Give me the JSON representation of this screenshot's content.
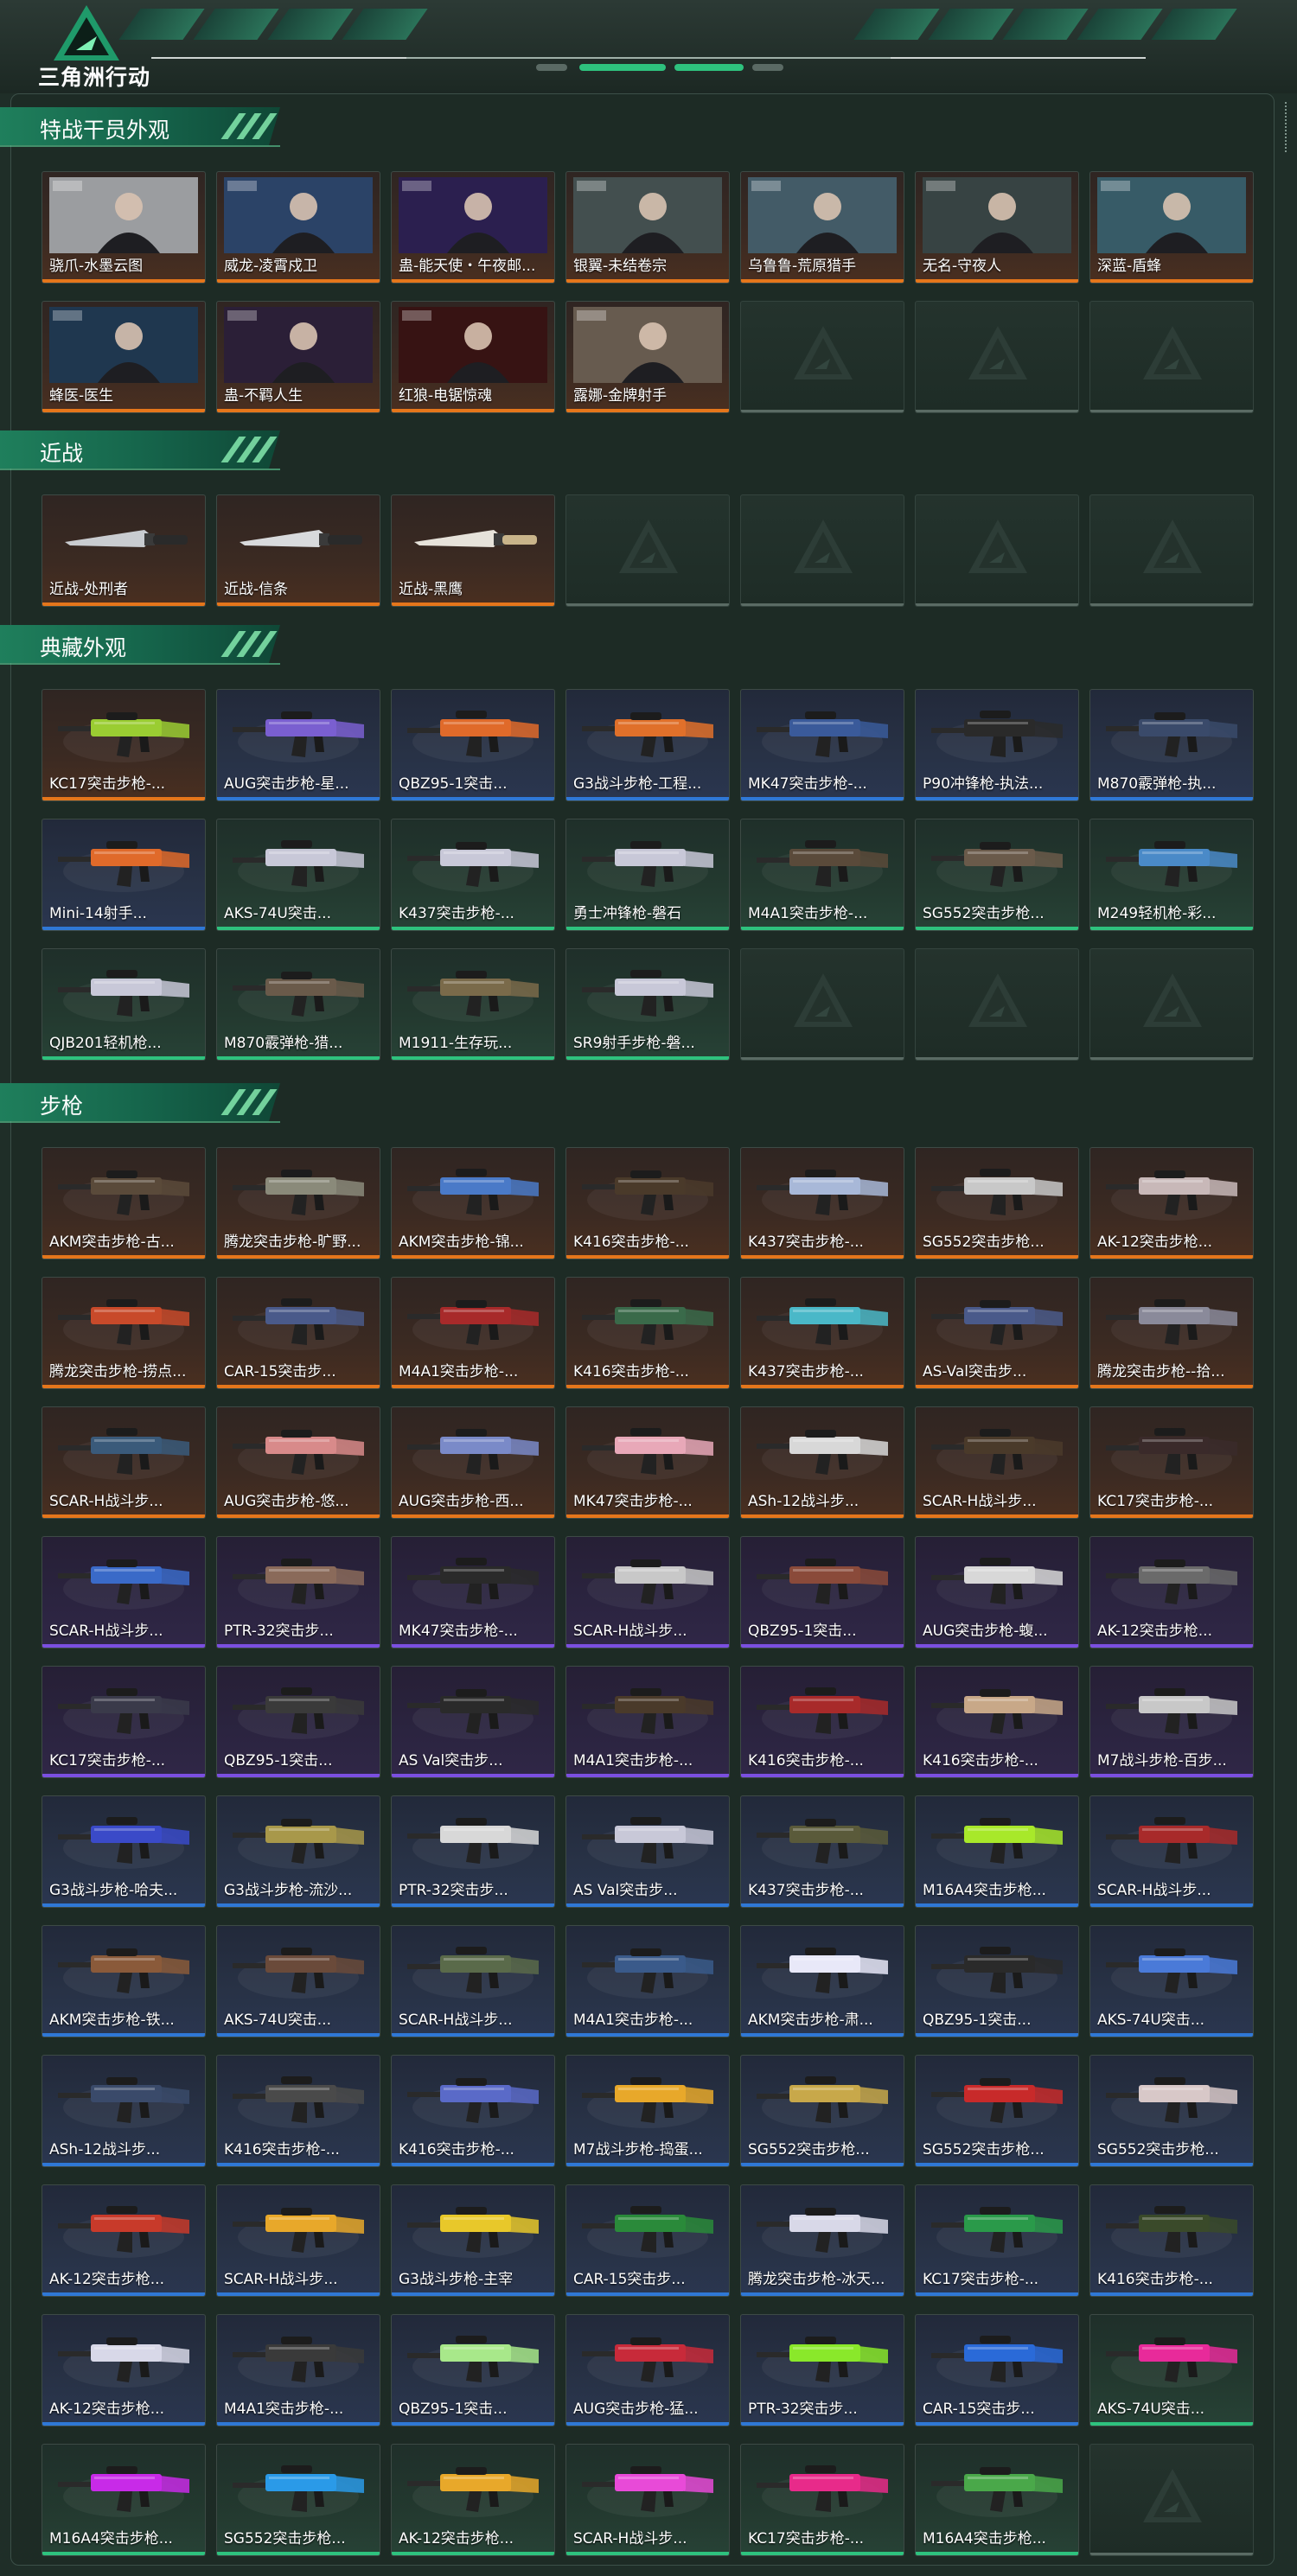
{
  "app": {
    "logo_text": "三角洲行动"
  },
  "colors": {
    "accent_green": "#2ec27e",
    "rarity_orange": "#e5761b",
    "rarity_blue": "#2f78d6",
    "rarity_purple": "#7b4fe0",
    "rarity_green": "#2ec27e",
    "empty_bar": "#5a6b64"
  },
  "sections": [
    {
      "id": "operators",
      "title": "特战干员外观",
      "items": [
        {
          "name": "骁爪-水墨云图",
          "rarity": "orange",
          "icon": "operator-portrait"
        },
        {
          "name": "威龙-凌霄戍卫",
          "rarity": "orange",
          "icon": "operator-portrait"
        },
        {
          "name": "蛊-能天使・午夜邮...",
          "rarity": "orange",
          "icon": "operator-portrait"
        },
        {
          "name": "银翼-未结卷宗",
          "rarity": "orange",
          "icon": "operator-portrait"
        },
        {
          "name": "乌鲁鲁-荒原猎手",
          "rarity": "orange",
          "icon": "operator-portrait"
        },
        {
          "name": "无名-守夜人",
          "rarity": "orange",
          "icon": "operator-portrait"
        },
        {
          "name": "深蓝-盾蜂",
          "rarity": "orange",
          "icon": "operator-portrait"
        },
        {
          "name": "蜂医-医生",
          "rarity": "orange",
          "icon": "operator-portrait"
        },
        {
          "name": "蛊-不羁人生",
          "rarity": "orange",
          "icon": "operator-portrait"
        },
        {
          "name": "红狼-电锯惊魂",
          "rarity": "orange",
          "icon": "operator-portrait"
        },
        {
          "name": "露娜-金牌射手",
          "rarity": "orange",
          "icon": "operator-portrait"
        },
        {
          "empty": true
        },
        {
          "empty": true
        },
        {
          "empty": true
        }
      ]
    },
    {
      "id": "melee",
      "title": "近战",
      "items": [
        {
          "name": "近战-处刑者",
          "rarity": "orange",
          "icon": "knife"
        },
        {
          "name": "近战-信条",
          "rarity": "orange",
          "icon": "knife"
        },
        {
          "name": "近战-黑鹰",
          "rarity": "orange",
          "icon": "knife"
        },
        {
          "empty": true
        },
        {
          "empty": true
        },
        {
          "empty": true
        },
        {
          "empty": true
        }
      ]
    },
    {
      "id": "collection",
      "title": "典藏外观",
      "items": [
        {
          "name": "KC17突击步枪-...",
          "rarity": "orange",
          "icon": "rifle",
          "skin": "#9acd32"
        },
        {
          "name": "AUG突击步枪-星...",
          "rarity": "blue",
          "icon": "rifle",
          "skin": "#7a5fd0"
        },
        {
          "name": "QBZ95-1突击...",
          "rarity": "blue",
          "icon": "rifle",
          "skin": "#e06a2a"
        },
        {
          "name": "G3战斗步枪-工程...",
          "rarity": "blue",
          "icon": "rifle",
          "skin": "#e0702a"
        },
        {
          "name": "MK47突击步枪-...",
          "rarity": "blue",
          "icon": "rifle",
          "skin": "#3a5a9a"
        },
        {
          "name": "P90冲锋枪-执法...",
          "rarity": "blue",
          "icon": "rifle",
          "skin": "#2a2a2a"
        },
        {
          "name": "M870霰弹枪-执...",
          "rarity": "blue",
          "icon": "rifle",
          "skin": "#3a4a6a"
        },
        {
          "name": "Mini-14射手...",
          "rarity": "blue",
          "icon": "rifle",
          "skin": "#e06a2a"
        },
        {
          "name": "AKS-74U突击...",
          "rarity": "green",
          "icon": "rifle",
          "skin": "#c8c8d8"
        },
        {
          "name": "K437突击步枪-...",
          "rarity": "green",
          "icon": "rifle",
          "skin": "#c8c8d8"
        },
        {
          "name": "勇士冲锋枪-磐石",
          "rarity": "green",
          "icon": "rifle",
          "skin": "#c8c8d8"
        },
        {
          "name": "M4A1突击步枪-...",
          "rarity": "green",
          "icon": "rifle",
          "skin": "#5a4a3a"
        },
        {
          "name": "SG552突击步枪...",
          "rarity": "green",
          "icon": "rifle",
          "skin": "#6a5a4a"
        },
        {
          "name": "M249轻机枪-彩...",
          "rarity": "green",
          "icon": "rifle",
          "skin": "#4a8ac8"
        },
        {
          "name": "QJB201轻机枪...",
          "rarity": "green",
          "icon": "rifle",
          "skin": "#c8c8d8"
        },
        {
          "name": "M870霰弹枪-猎...",
          "rarity": "green",
          "icon": "rifle",
          "skin": "#6a5a4a"
        },
        {
          "name": "M1911-生存玩...",
          "rarity": "green",
          "icon": "rifle",
          "skin": "#7a6a4a"
        },
        {
          "name": "SR9射手步枪-磐...",
          "rarity": "green",
          "icon": "rifle",
          "skin": "#c8c8d8"
        },
        {
          "empty": true
        },
        {
          "empty": true
        },
        {
          "empty": true
        }
      ]
    },
    {
      "id": "rifles",
      "title": "步枪",
      "items": [
        {
          "name": "AKM突击步枪-古...",
          "rarity": "orange",
          "icon": "rifle",
          "skin": "#5a4a3a"
        },
        {
          "name": "腾龙突击步枪-旷野...",
          "rarity": "orange",
          "icon": "rifle",
          "skin": "#8a8a7a"
        },
        {
          "name": "AKM突击步枪-锦...",
          "rarity": "orange",
          "icon": "rifle",
          "skin": "#4a7ac8"
        },
        {
          "name": "K416突击步枪-...",
          "rarity": "orange",
          "icon": "rifle",
          "skin": "#4a3a2a"
        },
        {
          "name": "K437突击步枪-...",
          "rarity": "orange",
          "icon": "rifle",
          "skin": "#a8b8d8"
        },
        {
          "name": "SG552突击步枪...",
          "rarity": "orange",
          "icon": "rifle",
          "skin": "#c8c8c8"
        },
        {
          "name": "AK-12突击步枪...",
          "rarity": "orange",
          "icon": "rifle",
          "skin": "#c8b8b8"
        },
        {
          "name": "腾龙突击步枪-捞点...",
          "rarity": "orange",
          "icon": "rifle",
          "skin": "#c84a2a"
        },
        {
          "name": "CAR-15突击步...",
          "rarity": "orange",
          "icon": "rifle",
          "skin": "#4a5a8a"
        },
        {
          "name": "M4A1突击步枪-...",
          "rarity": "orange",
          "icon": "rifle",
          "skin": "#a82a2a"
        },
        {
          "name": "K416突击步枪-...",
          "rarity": "orange",
          "icon": "rifle",
          "skin": "#3a6a4a"
        },
        {
          "name": "K437突击步枪-...",
          "rarity": "orange",
          "icon": "rifle",
          "skin": "#4ab8c8"
        },
        {
          "name": "AS-Val突击步...",
          "rarity": "orange",
          "icon": "rifle",
          "skin": "#4a5a8a"
        },
        {
          "name": "腾龙突击步枪--拾...",
          "rarity": "orange",
          "icon": "rifle",
          "skin": "#8a8a9a"
        },
        {
          "name": "SCAR-H战斗步...",
          "rarity": "orange",
          "icon": "rifle",
          "skin": "#3a5a7a"
        },
        {
          "name": "AUG突击步枪-悠...",
          "rarity": "orange",
          "icon": "rifle",
          "skin": "#d88a8a"
        },
        {
          "name": "AUG突击步枪-西...",
          "rarity": "orange",
          "icon": "rifle",
          "skin": "#7a8ac8"
        },
        {
          "name": "MK47突击步枪-...",
          "rarity": "orange",
          "icon": "rifle",
          "skin": "#e8a8b8"
        },
        {
          "name": "ASh-12战斗步...",
          "rarity": "orange",
          "icon": "rifle",
          "skin": "#d8d8d8"
        },
        {
          "name": "SCAR-H战斗步...",
          "rarity": "orange",
          "icon": "rifle",
          "skin": "#4a3a2a"
        },
        {
          "name": "KC17突击步枪-...",
          "rarity": "orange",
          "icon": "rifle",
          "skin": "#3a2a2a"
        },
        {
          "name": "SCAR-H战斗步...",
          "rarity": "purple",
          "icon": "rifle",
          "skin": "#3a6ac8"
        },
        {
          "name": "PTR-32突击步...",
          "rarity": "purple",
          "icon": "rifle",
          "skin": "#8a6a5a"
        },
        {
          "name": "MK47突击步枪-...",
          "rarity": "purple",
          "icon": "rifle",
          "skin": "#2a2a2a"
        },
        {
          "name": "SCAR-H战斗步...",
          "rarity": "purple",
          "icon": "rifle",
          "skin": "#c8c8c8"
        },
        {
          "name": "QBZ95-1突击...",
          "rarity": "purple",
          "icon": "rifle",
          "skin": "#8a4a3a"
        },
        {
          "name": "AUG突击步枪-蝮...",
          "rarity": "purple",
          "icon": "rifle",
          "skin": "#d8d8d8"
        },
        {
          "name": "AK-12突击步枪...",
          "rarity": "purple",
          "icon": "rifle",
          "skin": "#6a6a6a"
        },
        {
          "name": "KC17突击步枪-...",
          "rarity": "purple",
          "icon": "rifle",
          "skin": "#3a3a4a"
        },
        {
          "name": "QBZ95-1突击...",
          "rarity": "purple",
          "icon": "rifle",
          "skin": "#3a3a3a"
        },
        {
          "name": "AS Val突击步...",
          "rarity": "purple",
          "icon": "rifle",
          "skin": "#2a2a2a"
        },
        {
          "name": "M4A1突击步枪-...",
          "rarity": "purple",
          "icon": "rifle",
          "skin": "#4a3a2a"
        },
        {
          "name": "K416突击步枪-...",
          "rarity": "purple",
          "icon": "rifle",
          "skin": "#a82a2a"
        },
        {
          "name": "K416突击步枪-...",
          "rarity": "purple",
          "icon": "rifle",
          "skin": "#c8a888"
        },
        {
          "name": "M7战斗步枪-百步...",
          "rarity": "purple",
          "icon": "rifle",
          "skin": "#c8c8c8"
        },
        {
          "name": "G3战斗步枪-哈夫...",
          "rarity": "blue",
          "icon": "rifle",
          "skin": "#3a4ac8"
        },
        {
          "name": "G3战斗步枪-流沙...",
          "rarity": "blue",
          "icon": "rifle",
          "skin": "#a8984a"
        },
        {
          "name": "PTR-32突击步...",
          "rarity": "blue",
          "icon": "rifle",
          "skin": "#d8d8d8"
        },
        {
          "name": "AS Val突击步...",
          "rarity": "blue",
          "icon": "rifle",
          "skin": "#c8c8d8"
        },
        {
          "name": "K437突击步枪-...",
          "rarity": "blue",
          "icon": "rifle",
          "skin": "#5a5a3a"
        },
        {
          "name": "M16A4突击步枪...",
          "rarity": "blue",
          "icon": "rifle",
          "skin": "#a8e82a"
        },
        {
          "name": "SCAR-H战斗步...",
          "rarity": "blue",
          "icon": "rifle",
          "skin": "#a82a2a"
        },
        {
          "name": "AKM突击步枪-铁...",
          "rarity": "blue",
          "icon": "rifle",
          "skin": "#8a5a3a"
        },
        {
          "name": "AKS-74U突击...",
          "rarity": "blue",
          "icon": "rifle",
          "skin": "#6a4a3a"
        },
        {
          "name": "SCAR-H战斗步...",
          "rarity": "blue",
          "icon": "rifle",
          "skin": "#5a6a4a"
        },
        {
          "name": "M4A1突击步枪-...",
          "rarity": "blue",
          "icon": "rifle",
          "skin": "#3a5a8a"
        },
        {
          "name": "AKM突击步枪-肃...",
          "rarity": "blue",
          "icon": "rifle",
          "skin": "#e8e8f8"
        },
        {
          "name": "QBZ95-1突击...",
          "rarity": "blue",
          "icon": "rifle",
          "skin": "#2a2a2a"
        },
        {
          "name": "AKS-74U突击...",
          "rarity": "blue",
          "icon": "rifle",
          "skin": "#4a7ad8"
        },
        {
          "name": "ASh-12战斗步...",
          "rarity": "blue",
          "icon": "rifle",
          "skin": "#3a4a6a"
        },
        {
          "name": "K416突击步枪-...",
          "rarity": "blue",
          "icon": "rifle",
          "skin": "#4a4a4a"
        },
        {
          "name": "K416突击步枪-...",
          "rarity": "blue",
          "icon": "rifle",
          "skin": "#5a6ac8"
        },
        {
          "name": "M7战斗步枪-捣蛋...",
          "rarity": "blue",
          "icon": "rifle",
          "skin": "#e8a82a"
        },
        {
          "name": "SG552突击步枪...",
          "rarity": "blue",
          "icon": "rifle",
          "skin": "#c8a84a"
        },
        {
          "name": "SG552突击步枪...",
          "rarity": "blue",
          "icon": "rifle",
          "skin": "#c82a2a"
        },
        {
          "name": "SG552突击步枪...",
          "rarity": "blue",
          "icon": "rifle",
          "skin": "#d8c8c8"
        },
        {
          "name": "AK-12突击步枪...",
          "rarity": "blue",
          "icon": "rifle",
          "skin": "#c83a2a"
        },
        {
          "name": "SCAR-H战斗步...",
          "rarity": "blue",
          "icon": "rifle",
          "skin": "#e8a82a"
        },
        {
          "name": "G3战斗步枪-主宰",
          "rarity": "blue",
          "icon": "rifle",
          "skin": "#e8c82a"
        },
        {
          "name": "CAR-15突击步...",
          "rarity": "blue",
          "icon": "rifle",
          "skin": "#2a8a3a"
        },
        {
          "name": "腾龙突击步枪-冰天...",
          "rarity": "blue",
          "icon": "rifle",
          "skin": "#d8d8e8"
        },
        {
          "name": "KC17突击步枪-...",
          "rarity": "blue",
          "icon": "rifle",
          "skin": "#2a9a4a"
        },
        {
          "name": "K416突击步枪-...",
          "rarity": "blue",
          "icon": "rifle",
          "skin": "#3a4a2a"
        },
        {
          "name": "AK-12突击步枪...",
          "rarity": "blue",
          "icon": "rifle",
          "skin": "#d8d8e8"
        },
        {
          "name": "M4A1突击步枪-...",
          "rarity": "blue",
          "icon": "rifle",
          "skin": "#3a3a3a"
        },
        {
          "name": "QBZ95-1突击...",
          "rarity": "blue",
          "icon": "rifle",
          "skin": "#a8e88a"
        },
        {
          "name": "AUG突击步枪-猛...",
          "rarity": "blue",
          "icon": "rifle",
          "skin": "#c82a3a"
        },
        {
          "name": "PTR-32突击步...",
          "rarity": "blue",
          "icon": "rifle",
          "skin": "#8ae82a"
        },
        {
          "name": "CAR-15突击步...",
          "rarity": "blue",
          "icon": "rifle",
          "skin": "#2a6ad8"
        },
        {
          "name": "AKS-74U突击...",
          "rarity": "green",
          "icon": "rifle",
          "skin": "#e82a9a"
        },
        {
          "name": "M16A4突击步枪...",
          "rarity": "green",
          "icon": "rifle",
          "skin": "#c82ae8"
        },
        {
          "name": "SG552突击步枪...",
          "rarity": "green",
          "icon": "rifle",
          "skin": "#2a9ae8"
        },
        {
          "name": "AK-12突击步枪...",
          "rarity": "green",
          "icon": "rifle",
          "skin": "#e8a82a"
        },
        {
          "name": "SCAR-H战斗步...",
          "rarity": "green",
          "icon": "rifle",
          "skin": "#e84ad8"
        },
        {
          "name": "KC17突击步枪-...",
          "rarity": "green",
          "icon": "rifle",
          "skin": "#e82a8a"
        },
        {
          "name": "M16A4突击步枪...",
          "rarity": "green",
          "icon": "rifle",
          "skin": "#4aa84a"
        },
        {
          "empty": true
        }
      ]
    }
  ]
}
